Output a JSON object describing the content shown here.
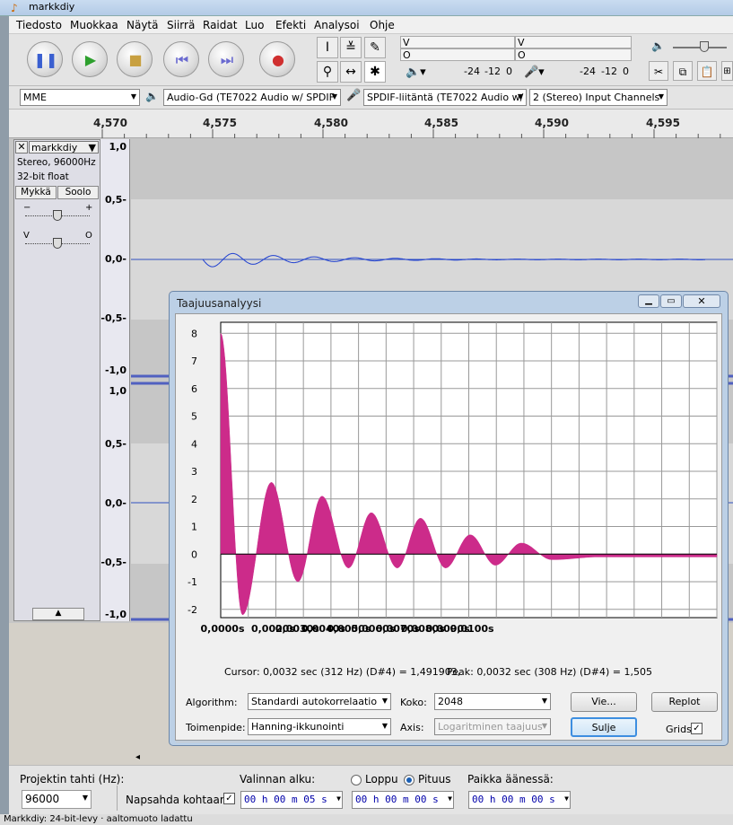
{
  "window": {
    "title": "markkdiy"
  },
  "menu": [
    "Tiedosto",
    "Muokkaa",
    "Näytä",
    "Siirrä",
    "Raidat",
    "Luo",
    "Efekti",
    "Analysoi",
    "Ohje"
  ],
  "meters": {
    "l": "V",
    "r": "O",
    "ticks": [
      "-24",
      "-12",
      "0"
    ]
  },
  "devices": {
    "host": "MME",
    "output": "Audio-Gd (TE7022 Audio w/ SPDIF",
    "input": "SPDIF-liitäntä (TE7022 Audio w/",
    "channels": "2 (Stereo) Input Channels"
  },
  "ruler": [
    "4,570",
    "4,575",
    "4,580",
    "4,585",
    "4,590",
    "4,595"
  ],
  "track": {
    "name": "markkdiy",
    "format": "Stereo, 96000Hz",
    "depth": "32-bit float",
    "mute": "Mykkä",
    "solo": "Soolo",
    "gain_minus": "−",
    "gain_plus": "+",
    "pan_left": "V",
    "pan_right": "O",
    "scale": [
      "1,0",
      "0,5-",
      "0,0-",
      "-0,5-",
      "-1,0",
      "1,0",
      "0,5-",
      "0,0-",
      "-0,5-",
      "-1,0"
    ]
  },
  "dialog": {
    "title": "Taajuusanalyysi",
    "cursor": "Cursor: 0,0032 sec (312 Hz) (D#4) = 1,491903,",
    "peak": "Peak: 0,0032 sec (308 Hz) (D#4) = 1,505",
    "algorithm_label": "Algorithm:",
    "algorithm": "Standardi autokorrelaatio",
    "size_label": "Koko:",
    "size": "2048",
    "export": "Vie...",
    "replot": "Replot",
    "function_label": "Toimenpide:",
    "function": "Hanning-ikkunointi",
    "axis_label": "Axis:",
    "axis": "Logaritminen taajuus",
    "close": "Sulje",
    "grids": "Grids"
  },
  "chart_data": {
    "type": "area",
    "ylim": [
      -2.3,
      8.4
    ],
    "xlim": [
      0,
      0.1048
    ],
    "yticks": [
      "8",
      "7",
      "6",
      "5",
      "4",
      "3",
      "2",
      "1",
      "0",
      "-1",
      "-2"
    ],
    "xticks": [
      "0,0000s",
      "0,0020s",
      "0,0030s",
      "0,0040s",
      "0,0050s",
      "0,0060s",
      "0,0070s",
      "0,0080s",
      "0,0090s",
      "0,0100s"
    ],
    "color": "#cc2b8a",
    "peaks": [
      {
        "x": 0.0,
        "y": 8.0
      },
      {
        "x": 0.0046,
        "y": -2.2
      },
      {
        "x": 0.0107,
        "y": 2.6
      },
      {
        "x": 0.0163,
        "y": -1.0
      },
      {
        "x": 0.0214,
        "y": 2.1
      },
      {
        "x": 0.027,
        "y": -0.5
      },
      {
        "x": 0.0318,
        "y": 1.5
      },
      {
        "x": 0.0373,
        "y": -0.5
      },
      {
        "x": 0.0422,
        "y": 1.3
      },
      {
        "x": 0.0475,
        "y": -0.5
      },
      {
        "x": 0.0527,
        "y": 0.7
      },
      {
        "x": 0.058,
        "y": -0.4
      },
      {
        "x": 0.0635,
        "y": 0.4
      },
      {
        "x": 0.07,
        "y": -0.2
      },
      {
        "x": 0.08,
        "y": -0.1
      },
      {
        "x": 0.1048,
        "y": -0.1
      }
    ]
  },
  "bottom": {
    "rate_label": "Projektin tahti (Hz):",
    "rate": "96000",
    "snap": "Napsahda kohtaan",
    "sel_start_label": "Valinnan alku:",
    "end": "Loppu",
    "length": "Pituus",
    "pos_label": "Paikka äänessä:",
    "tc1": "00 h 00 m 05 s",
    "tc2": "00 h 00 m 00 s",
    "tc3": "00 h 00 m 00 s"
  },
  "status": "Markkdiy: 24-bit-levy · aaltomuoto ladattu"
}
